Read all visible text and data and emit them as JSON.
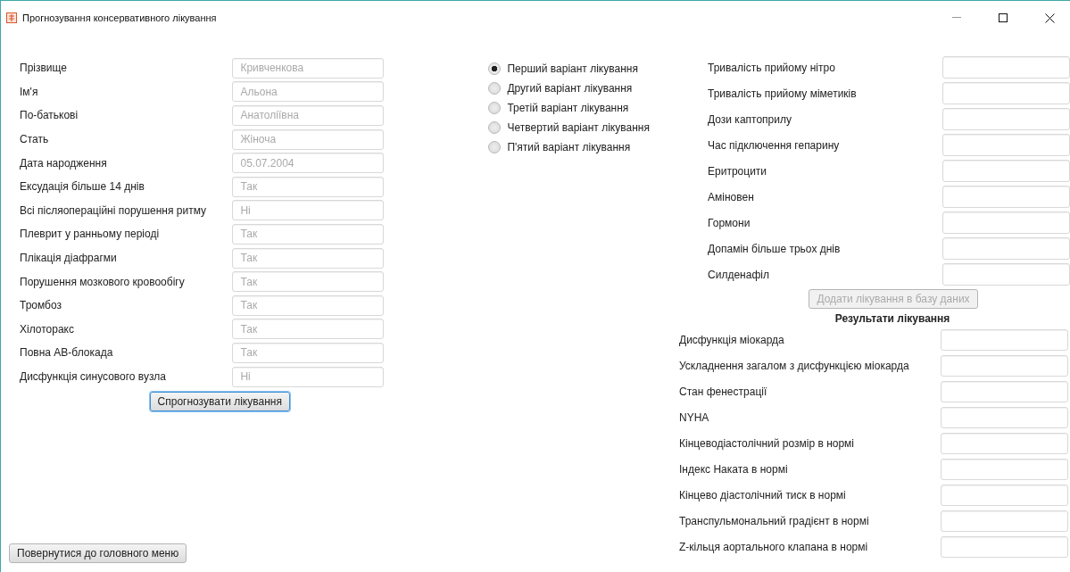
{
  "window": {
    "title": "Прогнозування консервативного лікування"
  },
  "patient_fields": [
    {
      "label": "Прізвище",
      "value": "Кривченкова"
    },
    {
      "label": "Ім'я",
      "value": "Альона"
    },
    {
      "label": "По-батькові",
      "value": "Анатоліївна"
    },
    {
      "label": "Стать",
      "value": "Жіноча"
    },
    {
      "label": "Дата народження",
      "value": "05.07.2004"
    },
    {
      "label": "Ексудація більше 14 днів",
      "value": "Так"
    },
    {
      "label": "Всі післяопераційні порушення ритму",
      "value": "Ні"
    },
    {
      "label": "Плеврит у ранньому періоді",
      "value": "Так"
    },
    {
      "label": "Плікація діафрагми",
      "value": "Так"
    },
    {
      "label": "Порушення мозкового кровообігу",
      "value": "Так"
    },
    {
      "label": "Тромбоз",
      "value": "Так"
    },
    {
      "label": "Хілоторакс",
      "value": "Так"
    },
    {
      "label": "Повна АВ-блокада",
      "value": "Так"
    },
    {
      "label": "Дисфункція синусового вузла",
      "value": "Ні"
    }
  ],
  "predict_button": {
    "label": "Спрогнозувати лікування",
    "focused": true
  },
  "treatment_options": [
    {
      "label": "Перший варіант лікування",
      "selected": true
    },
    {
      "label": "Другий варіант лікування",
      "selected": false
    },
    {
      "label": "Третій варіант лікування",
      "selected": false
    },
    {
      "label": "Четвертий варіант лікування",
      "selected": false
    },
    {
      "label": "П'ятий варіант лікування",
      "selected": false
    }
  ],
  "treatment_fields": [
    {
      "label": "Тривалість прийому нітро"
    },
    {
      "label": "Тривалість прийому міметиків"
    },
    {
      "label": "Дози каптоприлу"
    },
    {
      "label": "Час підключення гепарину"
    },
    {
      "label": "Еритроцити"
    },
    {
      "label": "Аміновен"
    },
    {
      "label": "Гормони"
    },
    {
      "label": "Допамін більше трьох днів"
    },
    {
      "label": "Силденафіл"
    }
  ],
  "add_button": {
    "label": "Додати лікування в базу даних",
    "disabled": true
  },
  "results": {
    "title": "Результати лікування",
    "fields": [
      {
        "label": "Дисфункція міокарда"
      },
      {
        "label": "Ускладнення загалом з дисфункцією міокарда"
      },
      {
        "label": "Стан фенестрації"
      },
      {
        "label": "NYHA"
      },
      {
        "label": "Кінцеводіастолічний розмір в нормі"
      },
      {
        "label": "Індекс Наката в нормі"
      },
      {
        "label": "Кінцево діастолічний тиск в нормі"
      },
      {
        "label": "Транспульмональний градієнт в нормі"
      },
      {
        "label": "Z-кільця аортального клапана в нормі"
      }
    ]
  },
  "back_button": {
    "label": "Повернутися до головного меню"
  }
}
